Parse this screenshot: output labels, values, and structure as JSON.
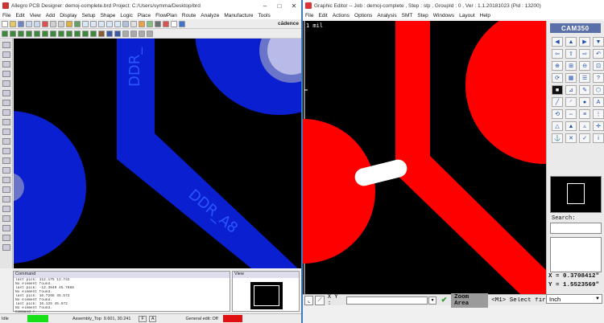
{
  "left_window": {
    "title": "Allegro PCB Designer: demoj-complete.brd  Project: C:/Users/symma/Desktop/brd",
    "cadence_brand": "cādence",
    "menu": [
      "File",
      "Edit",
      "View",
      "Add",
      "Display",
      "Setup",
      "Shape",
      "Logic",
      "Place",
      "FlowPlan",
      "Route",
      "Analyze",
      "Manufacture",
      "Tools"
    ],
    "trace_labels": {
      "top": "DDR_",
      "bottom": "DDR_A8"
    },
    "command_panel": {
      "header": "Command",
      "lines": [
        "last pick:  112.175 12.742",
        "No element found.",
        "last pick:  -12.3849 45.7888",
        "No element found.",
        "last pick:  16.7265 45.572",
        "No element found.",
        "last pick:  16.125 45.572",
        "No element found.",
        "Command >"
      ]
    },
    "view_panel": {
      "header": "View"
    },
    "status": {
      "left": "Idle",
      "subclass": "Assembly_Top",
      "coords": "9.601, 30.241",
      "f_key": "F",
      "a_key": "A",
      "edit_state": "General edit: Off"
    }
  },
  "right_window": {
    "title": "Graphic Editor -- Job : demoj-complete , Step : stp , GroupId : 0 , Ver : 1.1.20181023 (Pid : 13200)",
    "menu": [
      "File",
      "Edit",
      "Actions",
      "Options",
      "Analysis",
      "SMT",
      "Step",
      "Windows",
      "Layout",
      "Help"
    ],
    "scale_label": "1 mil",
    "brand": "CAM350",
    "search_label": "Search:",
    "coords": {
      "x": "X = 0.3708412\"",
      "y": "Y = 1.5523569\""
    },
    "unit": "Inch",
    "xy_label": "X Y :",
    "zoom_button": "Zoom Area",
    "prompt": "<M1> Select firs"
  },
  "colors": {
    "trace_blue": "#0a1fd0",
    "pad_red": "#ff0000",
    "background": "#000000"
  }
}
